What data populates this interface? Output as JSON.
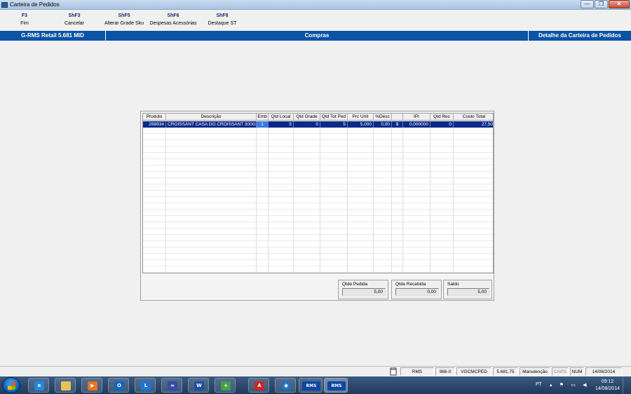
{
  "window": {
    "title": "Carteira de Pedidos",
    "minimize_glyph": "—",
    "restore_glyph": "❐",
    "close_glyph": "✕"
  },
  "toolbar": {
    "keys": [
      {
        "key": "F3",
        "label": "Fim"
      },
      {
        "key": "ShF3",
        "label": "Cancelar"
      },
      {
        "key": "ShF5",
        "label": "Alterar Grade Sku"
      },
      {
        "key": "ShF6",
        "label": "Despesas Acessórias"
      },
      {
        "key": "ShF8",
        "label": "Destaque ST"
      }
    ]
  },
  "header": {
    "app": "G-RMS Retail 5.681 MID",
    "module": "Compras",
    "screen": "Detalhe da Carteira de Pedidos",
    "color": "#0a53a5"
  },
  "grid": {
    "columns": [
      "Produto",
      "Descrição",
      "Emb",
      "Qtd Local",
      "Qtd Grade",
      "Qtd Tot Ped",
      "Prc Unit",
      "%Desc",
      "",
      "IPI",
      "Qtd Rec",
      "Custo Total"
    ],
    "rows": [
      {
        "produto": "288934",
        "descricao": "CROISSANT CASA DO CROISSANT 300G",
        "emb": "1",
        "qtd_local": "5",
        "qtd_grade": "0",
        "qtd_tot_ped": "5",
        "prc_unit": "5,000",
        "desc": "0,00",
        "moeda": "$",
        "ipi": "0,000000",
        "qtd_rec": "0",
        "custo_total": "27,50"
      }
    ],
    "selection_color": "#0a2a8a"
  },
  "totals": {
    "pedida": {
      "label": "Qtde Pedida",
      "value": "5,00"
    },
    "recebida": {
      "label": "Qtde Recebida",
      "value": "0,00"
    },
    "saldo": {
      "label": "Saldo",
      "value": "5,00"
    }
  },
  "statusbar": {
    "icon": "page-icon",
    "system": "RMS",
    "code": "966-0",
    "program": "VGCMCPED",
    "version": "5.681.75",
    "mode": "Manutenção",
    "caps": "CAPS",
    "num": "NUM",
    "date": "14/08/2014"
  },
  "taskbar": {
    "apps": [
      "Internet Explorer",
      "Windows Explorer",
      "Media Player",
      "Outlook",
      "Lync",
      "App",
      "Word",
      "App",
      "Acrobat",
      "App",
      "RMS",
      "RMS"
    ],
    "rms_label": "RMS",
    "lang": "PT",
    "time": "09:12",
    "date": "14/08/2014"
  }
}
